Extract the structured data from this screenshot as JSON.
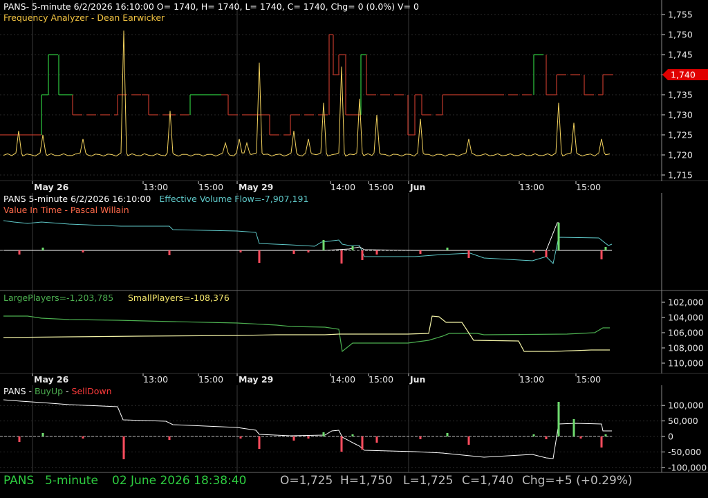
{
  "panel1": {
    "header": "PANS- 5-minute 6/2/2026 16:10:00 O= 1740, H= 1740, L= 1740, C= 1740, Chg= 0 (0.0%) V= 0",
    "indicator": "Frequency Analyzer - Dean Earwicker",
    "last_price_tag": "1,740",
    "axis_labels": [
      "1,755",
      "1,750",
      "1,745",
      "1,740",
      "1,735",
      "1,730",
      "1,725",
      "1,720",
      "1,715"
    ],
    "axis_values": [
      1755,
      1750,
      1745,
      1740,
      1735,
      1730,
      1725,
      1720,
      1715
    ]
  },
  "date_axis": [
    "May 26",
    "13:00",
    "15:00",
    "May 29",
    "14:00",
    "15:00",
    "Jun",
    "13:00",
    "15:00"
  ],
  "panel2": {
    "header": "PANS 5-minute  6/2/2026 16:10:00",
    "effective": "Effective Volume Flow=-7,907,191",
    "indicator": "Value In Time - Pascal Willain"
  },
  "panel3": {
    "large": "LargePlayers=-1,203,785",
    "small": "SmallPlayers=-108,376",
    "axis_labels": [
      "102,000",
      "104,000",
      "106,000",
      "108,000",
      "110,000"
    ]
  },
  "panel4": {
    "title_prefix": "PANS - ",
    "buy": "BuyUp",
    "dash": "-",
    "sell": "SellDown",
    "axis_labels": [
      "100,000",
      "50,000",
      "0",
      "-50,000",
      "-100,000"
    ]
  },
  "status": {
    "symbol": "PANS",
    "interval": "5-minute",
    "datetime": "02 June 2026 18:38:40",
    "open": "O=1,725",
    "high": "H=1,750",
    "low": "L=1,725",
    "close": "C=1,740",
    "change": "Chg=+5 (+0.29%)"
  },
  "colors": {
    "background": "#000000",
    "grid": "#3a3a3a",
    "price_green": "#2ecc40",
    "price_red": "#c0392b",
    "frequency": "#f4d35e",
    "cyan": "#5fc9c9",
    "white": "#ffffff",
    "green_line": "#4caf50",
    "yellow_line": "#f2f2a6",
    "status_green": "#2ecc40",
    "status_gray": "#bdbdbd"
  },
  "chart_data": [
    {
      "type": "line",
      "title": "Frequency Analyzer - Dean Earwicker",
      "xlabel": "",
      "ylabel": "",
      "ylim": [
        1713,
        1757
      ],
      "x": [
        "May 26",
        "13:00",
        "15:00",
        "May 29",
        "14:00",
        "15:00",
        "Jun",
        "13:00",
        "15:00"
      ],
      "series": [
        {
          "name": "Price",
          "values": [
            1725,
            1735,
            1730,
            1735,
            1730,
            1725,
            1745,
            1735,
            1740
          ]
        },
        {
          "name": "Frequency",
          "values": [
            1721,
            1751,
            1720,
            1743,
            1733,
            1720,
            1725,
            1733,
            1720
          ]
        }
      ]
    },
    {
      "type": "line",
      "title": "Value In Time - Pascal Willain",
      "xlabel": "",
      "ylabel": "",
      "series": [
        {
          "name": "Effective Volume Flow",
          "values": [
            -7907191
          ]
        }
      ]
    },
    {
      "type": "line",
      "title": "",
      "xlabel": "",
      "ylabel": "",
      "ylim": [
        101000,
        111000
      ],
      "series": [
        {
          "name": "LargePlayers",
          "values": [
            104000,
            104300,
            104800,
            105400,
            107200,
            106500,
            106000,
            105700,
            105400
          ]
        },
        {
          "name": "SmallPlayers",
          "values": [
            106200,
            106000,
            105900,
            105800,
            105800,
            104000,
            106300,
            107200,
            107200
          ]
        }
      ]
    },
    {
      "type": "bar",
      "title": "PANS - BuyUp-SellDown",
      "xlabel": "",
      "ylabel": "",
      "ylim": [
        -105000,
        110000
      ],
      "series": [
        {
          "name": "BuyUp",
          "values": [
            10000,
            0,
            0,
            15000,
            20000,
            15000,
            10000,
            110000,
            55000
          ]
        },
        {
          "name": "SellDown",
          "values": [
            -8000,
            -70000,
            -10000,
            -45000,
            -25000,
            -10000,
            -15000,
            -5000,
            -35000
          ]
        }
      ]
    }
  ]
}
